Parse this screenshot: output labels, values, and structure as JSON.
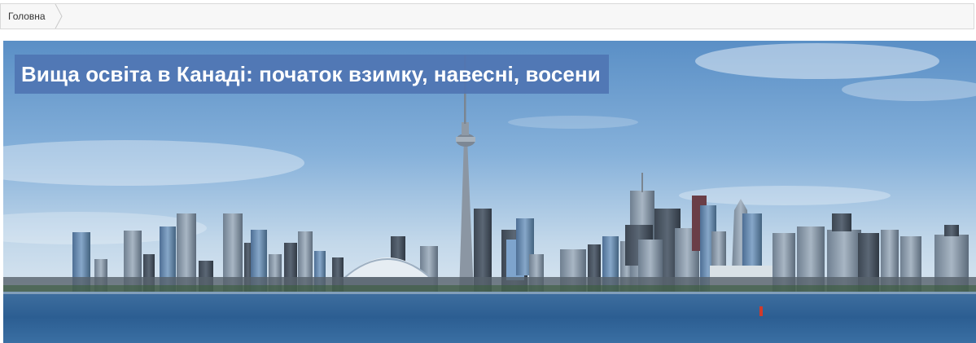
{
  "breadcrumb": {
    "items": [
      {
        "label": "Головна"
      }
    ]
  },
  "hero": {
    "title": "Вища освіта в Канаді: початок взимку, навесні, восени",
    "image_subject": "toronto-skyline",
    "colors": {
      "title_background": "#4f75b3",
      "title_text": "#ffffff",
      "sky_top": "#5f94c9",
      "sky_bottom": "#c5d9ea",
      "water": "#2b5f93"
    }
  }
}
